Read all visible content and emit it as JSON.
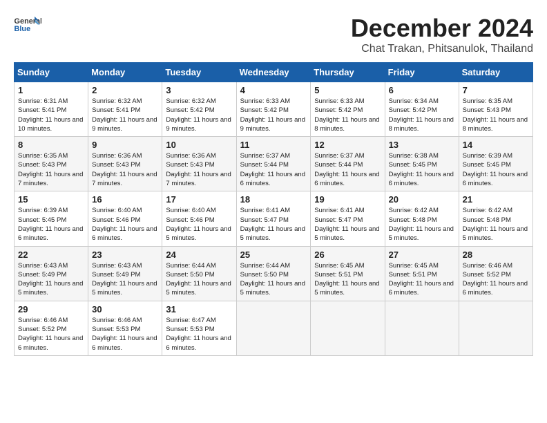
{
  "header": {
    "logo_general": "General",
    "logo_blue": "Blue",
    "month_title": "December 2024",
    "location": "Chat Trakan, Phitsanulok, Thailand"
  },
  "days_of_week": [
    "Sunday",
    "Monday",
    "Tuesday",
    "Wednesday",
    "Thursday",
    "Friday",
    "Saturday"
  ],
  "weeks": [
    [
      {
        "day": "1",
        "sunrise": "6:31 AM",
        "sunset": "5:41 PM",
        "daylight": "11 hours and 10 minutes."
      },
      {
        "day": "2",
        "sunrise": "6:32 AM",
        "sunset": "5:41 PM",
        "daylight": "11 hours and 9 minutes."
      },
      {
        "day": "3",
        "sunrise": "6:32 AM",
        "sunset": "5:42 PM",
        "daylight": "11 hours and 9 minutes."
      },
      {
        "day": "4",
        "sunrise": "6:33 AM",
        "sunset": "5:42 PM",
        "daylight": "11 hours and 9 minutes."
      },
      {
        "day": "5",
        "sunrise": "6:33 AM",
        "sunset": "5:42 PM",
        "daylight": "11 hours and 8 minutes."
      },
      {
        "day": "6",
        "sunrise": "6:34 AM",
        "sunset": "5:42 PM",
        "daylight": "11 hours and 8 minutes."
      },
      {
        "day": "7",
        "sunrise": "6:35 AM",
        "sunset": "5:43 PM",
        "daylight": "11 hours and 8 minutes."
      }
    ],
    [
      {
        "day": "8",
        "sunrise": "6:35 AM",
        "sunset": "5:43 PM",
        "daylight": "11 hours and 7 minutes."
      },
      {
        "day": "9",
        "sunrise": "6:36 AM",
        "sunset": "5:43 PM",
        "daylight": "11 hours and 7 minutes."
      },
      {
        "day": "10",
        "sunrise": "6:36 AM",
        "sunset": "5:43 PM",
        "daylight": "11 hours and 7 minutes."
      },
      {
        "day": "11",
        "sunrise": "6:37 AM",
        "sunset": "5:44 PM",
        "daylight": "11 hours and 6 minutes."
      },
      {
        "day": "12",
        "sunrise": "6:37 AM",
        "sunset": "5:44 PM",
        "daylight": "11 hours and 6 minutes."
      },
      {
        "day": "13",
        "sunrise": "6:38 AM",
        "sunset": "5:45 PM",
        "daylight": "11 hours and 6 minutes."
      },
      {
        "day": "14",
        "sunrise": "6:39 AM",
        "sunset": "5:45 PM",
        "daylight": "11 hours and 6 minutes."
      }
    ],
    [
      {
        "day": "15",
        "sunrise": "6:39 AM",
        "sunset": "5:45 PM",
        "daylight": "11 hours and 6 minutes."
      },
      {
        "day": "16",
        "sunrise": "6:40 AM",
        "sunset": "5:46 PM",
        "daylight": "11 hours and 6 minutes."
      },
      {
        "day": "17",
        "sunrise": "6:40 AM",
        "sunset": "5:46 PM",
        "daylight": "11 hours and 5 minutes."
      },
      {
        "day": "18",
        "sunrise": "6:41 AM",
        "sunset": "5:47 PM",
        "daylight": "11 hours and 5 minutes."
      },
      {
        "day": "19",
        "sunrise": "6:41 AM",
        "sunset": "5:47 PM",
        "daylight": "11 hours and 5 minutes."
      },
      {
        "day": "20",
        "sunrise": "6:42 AM",
        "sunset": "5:48 PM",
        "daylight": "11 hours and 5 minutes."
      },
      {
        "day": "21",
        "sunrise": "6:42 AM",
        "sunset": "5:48 PM",
        "daylight": "11 hours and 5 minutes."
      }
    ],
    [
      {
        "day": "22",
        "sunrise": "6:43 AM",
        "sunset": "5:49 PM",
        "daylight": "11 hours and 5 minutes."
      },
      {
        "day": "23",
        "sunrise": "6:43 AM",
        "sunset": "5:49 PM",
        "daylight": "11 hours and 5 minutes."
      },
      {
        "day": "24",
        "sunrise": "6:44 AM",
        "sunset": "5:50 PM",
        "daylight": "11 hours and 5 minutes."
      },
      {
        "day": "25",
        "sunrise": "6:44 AM",
        "sunset": "5:50 PM",
        "daylight": "11 hours and 5 minutes."
      },
      {
        "day": "26",
        "sunrise": "6:45 AM",
        "sunset": "5:51 PM",
        "daylight": "11 hours and 5 minutes."
      },
      {
        "day": "27",
        "sunrise": "6:45 AM",
        "sunset": "5:51 PM",
        "daylight": "11 hours and 6 minutes."
      },
      {
        "day": "28",
        "sunrise": "6:46 AM",
        "sunset": "5:52 PM",
        "daylight": "11 hours and 6 minutes."
      }
    ],
    [
      {
        "day": "29",
        "sunrise": "6:46 AM",
        "sunset": "5:52 PM",
        "daylight": "11 hours and 6 minutes."
      },
      {
        "day": "30",
        "sunrise": "6:46 AM",
        "sunset": "5:53 PM",
        "daylight": "11 hours and 6 minutes."
      },
      {
        "day": "31",
        "sunrise": "6:47 AM",
        "sunset": "5:53 PM",
        "daylight": "11 hours and 6 minutes."
      },
      null,
      null,
      null,
      null
    ]
  ]
}
